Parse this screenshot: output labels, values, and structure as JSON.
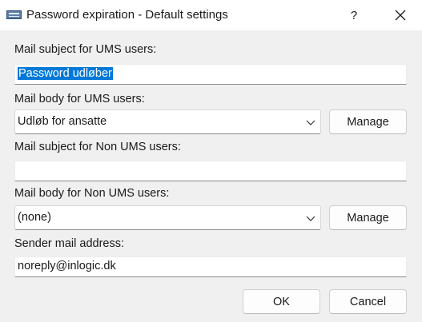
{
  "window": {
    "title": "Password expiration - Default settings",
    "help_glyph": "?"
  },
  "form": {
    "ums_subject_label": "Mail subject for UMS users:",
    "ums_subject_value": "Password udløber",
    "ums_body_label": "Mail body for UMS users:",
    "ums_body_selected": "Udløb for ansatte",
    "non_ums_subject_label": "Mail subject for Non UMS users:",
    "non_ums_subject_value": "",
    "non_ums_body_label": "Mail body for Non UMS users:",
    "non_ums_body_selected": "(none)",
    "sender_label": "Sender mail address:",
    "sender_value": "noreply@inlogic.dk"
  },
  "buttons": {
    "manage": "Manage",
    "ok": "OK",
    "cancel": "Cancel"
  }
}
